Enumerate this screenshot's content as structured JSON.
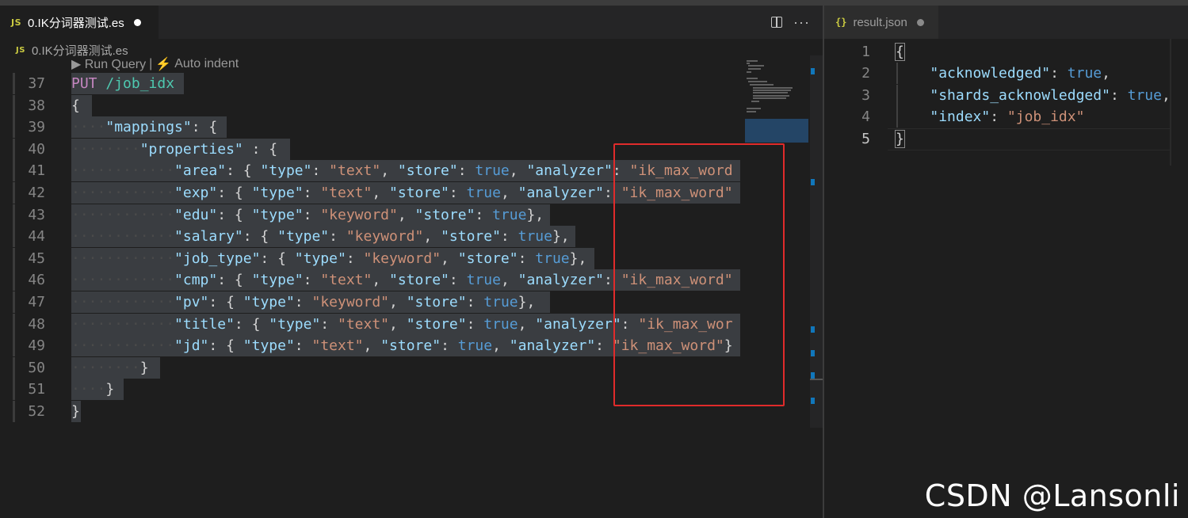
{
  "left_tab": {
    "badge": "JS",
    "title": "0.IK分词器测试.es"
  },
  "breadcrumb": {
    "badge": "JS",
    "file": "0.IK分词器测试.es"
  },
  "codelens": {
    "run": "▶ Run Query",
    "sep": "|",
    "bolt": "⚡",
    "indent": "Auto indent"
  },
  "code_lines": [
    {
      "n": "37",
      "parts": [
        {
          "t": "PUT",
          "c": "k-put"
        },
        {
          "t": " /job_idx",
          "c": "k-path"
        }
      ]
    },
    {
      "n": "38",
      "parts": [
        {
          "t": "{",
          "c": "k-punc"
        }
      ]
    },
    {
      "n": "39",
      "parts": [
        {
          "t": "····",
          "c": "dots"
        },
        {
          "t": "\"mappings\"",
          "c": "k-key"
        },
        {
          "t": ": {",
          "c": "k-punc"
        }
      ]
    },
    {
      "n": "40",
      "parts": [
        {
          "t": "········",
          "c": "dots"
        },
        {
          "t": "\"properties\"",
          "c": "k-key"
        },
        {
          "t": " : {",
          "c": "k-punc"
        }
      ]
    },
    {
      "n": "41",
      "parts": [
        {
          "t": "············",
          "c": "dots"
        },
        {
          "t": "\"area\"",
          "c": "k-key"
        },
        {
          "t": ": { ",
          "c": "k-punc"
        },
        {
          "t": "\"type\"",
          "c": "k-key"
        },
        {
          "t": ": ",
          "c": "k-punc"
        },
        {
          "t": "\"text\"",
          "c": "k-str"
        },
        {
          "t": ", ",
          "c": "k-punc"
        },
        {
          "t": "\"store\"",
          "c": "k-key"
        },
        {
          "t": ": ",
          "c": "k-punc"
        },
        {
          "t": "true",
          "c": "k-bool"
        },
        {
          "t": ", ",
          "c": "k-punc"
        },
        {
          "t": "\"analyzer\"",
          "c": "k-key"
        },
        {
          "t": ": ",
          "c": "k-punc"
        },
        {
          "t": "\"ik_max_word",
          "c": "k-str"
        }
      ]
    },
    {
      "n": "42",
      "parts": [
        {
          "t": "············",
          "c": "dots"
        },
        {
          "t": "\"exp\"",
          "c": "k-key"
        },
        {
          "t": ": { ",
          "c": "k-punc"
        },
        {
          "t": "\"type\"",
          "c": "k-key"
        },
        {
          "t": ": ",
          "c": "k-punc"
        },
        {
          "t": "\"text\"",
          "c": "k-str"
        },
        {
          "t": ", ",
          "c": "k-punc"
        },
        {
          "t": "\"store\"",
          "c": "k-key"
        },
        {
          "t": ": ",
          "c": "k-punc"
        },
        {
          "t": "true",
          "c": "k-bool"
        },
        {
          "t": ", ",
          "c": "k-punc"
        },
        {
          "t": "\"analyzer\"",
          "c": "k-key"
        },
        {
          "t": ": ",
          "c": "k-punc"
        },
        {
          "t": "\"ik_max_word\"",
          "c": "k-str"
        }
      ]
    },
    {
      "n": "43",
      "parts": [
        {
          "t": "············",
          "c": "dots"
        },
        {
          "t": "\"edu\"",
          "c": "k-key"
        },
        {
          "t": ": { ",
          "c": "k-punc"
        },
        {
          "t": "\"type\"",
          "c": "k-key"
        },
        {
          "t": ": ",
          "c": "k-punc"
        },
        {
          "t": "\"keyword\"",
          "c": "k-str"
        },
        {
          "t": ", ",
          "c": "k-punc"
        },
        {
          "t": "\"store\"",
          "c": "k-key"
        },
        {
          "t": ": ",
          "c": "k-punc"
        },
        {
          "t": "true",
          "c": "k-bool"
        },
        {
          "t": "},",
          "c": "k-punc"
        }
      ]
    },
    {
      "n": "44",
      "parts": [
        {
          "t": "············",
          "c": "dots"
        },
        {
          "t": "\"salary\"",
          "c": "k-key"
        },
        {
          "t": ": { ",
          "c": "k-punc"
        },
        {
          "t": "\"type\"",
          "c": "k-key"
        },
        {
          "t": ": ",
          "c": "k-punc"
        },
        {
          "t": "\"keyword\"",
          "c": "k-str"
        },
        {
          "t": ", ",
          "c": "k-punc"
        },
        {
          "t": "\"store\"",
          "c": "k-key"
        },
        {
          "t": ": ",
          "c": "k-punc"
        },
        {
          "t": "true",
          "c": "k-bool"
        },
        {
          "t": "},",
          "c": "k-punc"
        }
      ]
    },
    {
      "n": "45",
      "parts": [
        {
          "t": "············",
          "c": "dots"
        },
        {
          "t": "\"job_type\"",
          "c": "k-key"
        },
        {
          "t": ": { ",
          "c": "k-punc"
        },
        {
          "t": "\"type\"",
          "c": "k-key"
        },
        {
          "t": ": ",
          "c": "k-punc"
        },
        {
          "t": "\"keyword\"",
          "c": "k-str"
        },
        {
          "t": ", ",
          "c": "k-punc"
        },
        {
          "t": "\"store\"",
          "c": "k-key"
        },
        {
          "t": ": ",
          "c": "k-punc"
        },
        {
          "t": "true",
          "c": "k-bool"
        },
        {
          "t": "},",
          "c": "k-punc"
        }
      ]
    },
    {
      "n": "46",
      "parts": [
        {
          "t": "············",
          "c": "dots"
        },
        {
          "t": "\"cmp\"",
          "c": "k-key"
        },
        {
          "t": ": { ",
          "c": "k-punc"
        },
        {
          "t": "\"type\"",
          "c": "k-key"
        },
        {
          "t": ": ",
          "c": "k-punc"
        },
        {
          "t": "\"text\"",
          "c": "k-str"
        },
        {
          "t": ", ",
          "c": "k-punc"
        },
        {
          "t": "\"store\"",
          "c": "k-key"
        },
        {
          "t": ": ",
          "c": "k-punc"
        },
        {
          "t": "true",
          "c": "k-bool"
        },
        {
          "t": ", ",
          "c": "k-punc"
        },
        {
          "t": "\"analyzer\"",
          "c": "k-key"
        },
        {
          "t": ": ",
          "c": "k-punc"
        },
        {
          "t": "\"ik_max_word\"",
          "c": "k-str"
        }
      ]
    },
    {
      "n": "47",
      "parts": [
        {
          "t": "············",
          "c": "dots"
        },
        {
          "t": "\"pv\"",
          "c": "k-key"
        },
        {
          "t": ": { ",
          "c": "k-punc"
        },
        {
          "t": "\"type\"",
          "c": "k-key"
        },
        {
          "t": ": ",
          "c": "k-punc"
        },
        {
          "t": "\"keyword\"",
          "c": "k-str"
        },
        {
          "t": ", ",
          "c": "k-punc"
        },
        {
          "t": "\"store\"",
          "c": "k-key"
        },
        {
          "t": ": ",
          "c": "k-punc"
        },
        {
          "t": "true",
          "c": "k-bool"
        },
        {
          "t": "},",
          "c": "k-punc"
        }
      ]
    },
    {
      "n": "48",
      "parts": [
        {
          "t": "············",
          "c": "dots"
        },
        {
          "t": "\"title\"",
          "c": "k-key"
        },
        {
          "t": ": { ",
          "c": "k-punc"
        },
        {
          "t": "\"type\"",
          "c": "k-key"
        },
        {
          "t": ": ",
          "c": "k-punc"
        },
        {
          "t": "\"text\"",
          "c": "k-str"
        },
        {
          "t": ", ",
          "c": "k-punc"
        },
        {
          "t": "\"store\"",
          "c": "k-key"
        },
        {
          "t": ": ",
          "c": "k-punc"
        },
        {
          "t": "true",
          "c": "k-bool"
        },
        {
          "t": ", ",
          "c": "k-punc"
        },
        {
          "t": "\"analyzer\"",
          "c": "k-key"
        },
        {
          "t": ": ",
          "c": "k-punc"
        },
        {
          "t": "\"ik_max_wor",
          "c": "k-str"
        }
      ]
    },
    {
      "n": "49",
      "parts": [
        {
          "t": "············",
          "c": "dots"
        },
        {
          "t": "\"jd\"",
          "c": "k-key"
        },
        {
          "t": ": { ",
          "c": "k-punc"
        },
        {
          "t": "\"type\"",
          "c": "k-key"
        },
        {
          "t": ": ",
          "c": "k-punc"
        },
        {
          "t": "\"text\"",
          "c": "k-str"
        },
        {
          "t": ", ",
          "c": "k-punc"
        },
        {
          "t": "\"store\"",
          "c": "k-key"
        },
        {
          "t": ": ",
          "c": "k-punc"
        },
        {
          "t": "true",
          "c": "k-bool"
        },
        {
          "t": ", ",
          "c": "k-punc"
        },
        {
          "t": "\"analyzer\"",
          "c": "k-key"
        },
        {
          "t": ": ",
          "c": "k-punc"
        },
        {
          "t": "\"ik_max_word\"",
          "c": "k-str"
        },
        {
          "t": "}",
          "c": "k-punc"
        }
      ]
    },
    {
      "n": "50",
      "parts": [
        {
          "t": "········",
          "c": "dots"
        },
        {
          "t": "}",
          "c": "k-punc"
        }
      ]
    },
    {
      "n": "51",
      "parts": [
        {
          "t": "····",
          "c": "dots"
        },
        {
          "t": "}",
          "c": "k-punc"
        }
      ]
    },
    {
      "n": "52",
      "parts": [
        {
          "t": "}",
          "c": "k-punc"
        }
      ]
    }
  ],
  "right_tab": {
    "badge": "{}",
    "title": "result.json"
  },
  "result_lines": [
    {
      "n": "1",
      "parts": [
        {
          "t": "{",
          "c": "k-punc"
        }
      ]
    },
    {
      "n": "2",
      "parts": [
        {
          "t": "    ",
          "c": "k-punc"
        },
        {
          "t": "\"acknowledged\"",
          "c": "k-key"
        },
        {
          "t": ": ",
          "c": "k-punc"
        },
        {
          "t": "true",
          "c": "k-bool"
        },
        {
          "t": ",",
          "c": "k-punc"
        }
      ]
    },
    {
      "n": "3",
      "parts": [
        {
          "t": "    ",
          "c": "k-punc"
        },
        {
          "t": "\"shards_acknowledged\"",
          "c": "k-key"
        },
        {
          "t": ": ",
          "c": "k-punc"
        },
        {
          "t": "true",
          "c": "k-bool"
        },
        {
          "t": ",",
          "c": "k-punc"
        }
      ]
    },
    {
      "n": "4",
      "parts": [
        {
          "t": "    ",
          "c": "k-punc"
        },
        {
          "t": "\"index\"",
          "c": "k-key"
        },
        {
          "t": ": ",
          "c": "k-punc"
        },
        {
          "t": "\"job_idx\"",
          "c": "k-str"
        }
      ]
    },
    {
      "n": "5",
      "parts": [
        {
          "t": "}",
          "c": "k-punc"
        }
      ]
    }
  ],
  "watermark": "CSDN @Lansonli"
}
